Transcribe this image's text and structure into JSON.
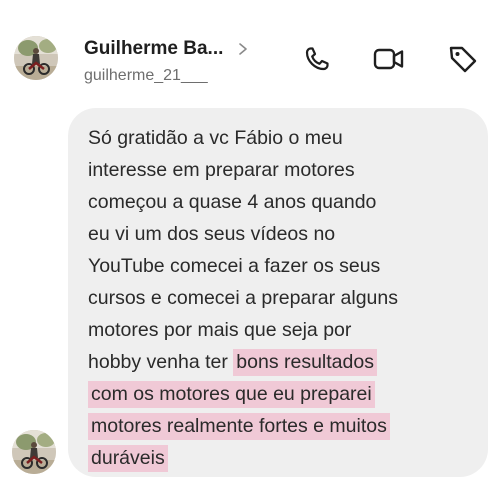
{
  "header": {
    "contact_name": "Guilherme Ba...",
    "contact_handle": "guilherme_21___",
    "actions": {
      "call_icon": "phone-icon",
      "video_icon": "video-camera-icon",
      "tag_icon": "tag-icon"
    }
  },
  "message": {
    "lines": [
      {
        "text": "Só gratidão a vc Fábio o meu",
        "hl": ""
      },
      {
        "text": "interesse em preparar motores",
        "hl": ""
      },
      {
        "text": "começou a quase 4 anos quando",
        "hl": ""
      },
      {
        "text": "eu vi um dos seus vídeos no",
        "hl": ""
      },
      {
        "text": "YouTube comecei a fazer os seus",
        "hl": ""
      },
      {
        "text": "cursos e comecei a preparar alguns",
        "hl": ""
      },
      {
        "text": "motores por mais que seja por",
        "hl": ""
      },
      {
        "text": "hobby venha ter ",
        "hl": "bons resultados"
      },
      {
        "text": "",
        "hl": "com os motores que eu preparei"
      },
      {
        "text": "",
        "hl": "motores realmente fortes e muitos"
      },
      {
        "text": "",
        "hl": "duráveis"
      }
    ]
  },
  "colors": {
    "bubble": "#efefef",
    "highlight": "#f0c9d6",
    "text": "#2a2a2a",
    "handle": "#6e6e6e"
  }
}
